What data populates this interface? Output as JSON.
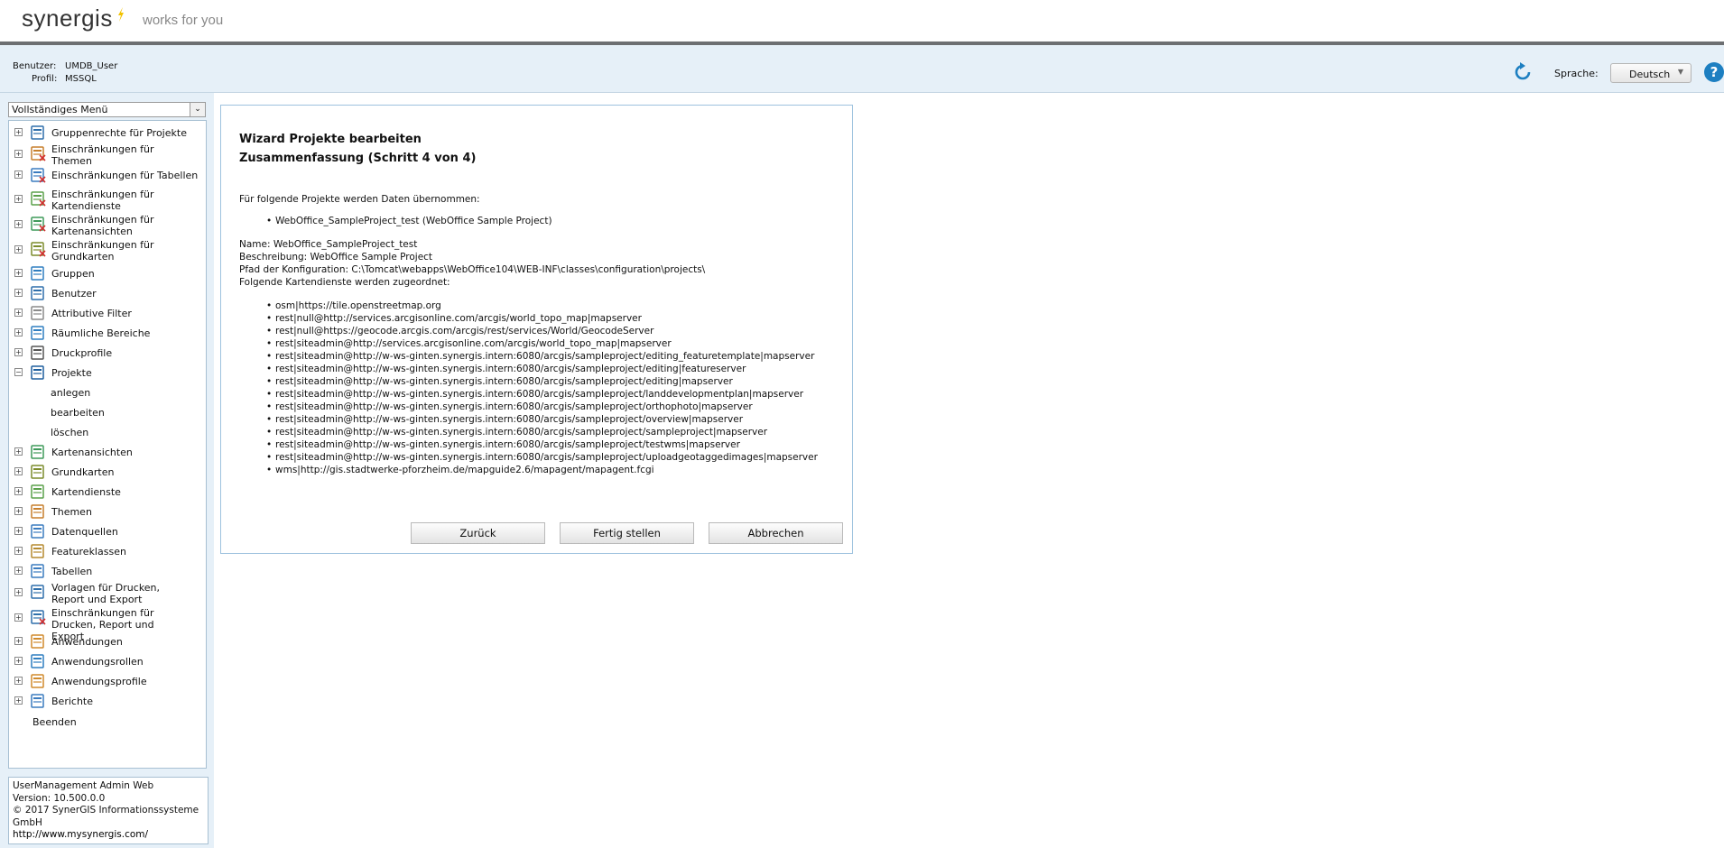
{
  "header": {
    "logo": "synergis",
    "tagline": "works for you"
  },
  "user_info": {
    "user_label": "Benutzer:",
    "user_value": "UMDB_User",
    "profile_label": "Profil:",
    "profile_value": "MSSQL"
  },
  "language": {
    "label": "Sprache:",
    "selected": "Deutsch"
  },
  "sidebar": {
    "menu_select": "Vollständiges Menü",
    "items": [
      {
        "label": "Gruppenrechte für Projekte",
        "icon": "group-rights-icon"
      },
      {
        "label": "Einschränkungen für Themen",
        "icon": "restrict-themes-icon"
      },
      {
        "label": "Einschränkungen für Tabellen",
        "icon": "restrict-tables-icon"
      },
      {
        "label": "Einschränkungen für Kartendienste",
        "icon": "restrict-mapservices-icon"
      },
      {
        "label": "Einschränkungen für Kartenansichten",
        "icon": "restrict-mapviews-icon"
      },
      {
        "label": "Einschränkungen für Grundkarten",
        "icon": "restrict-basemaps-icon"
      },
      {
        "label": "Gruppen",
        "icon": "groups-icon"
      },
      {
        "label": "Benutzer",
        "icon": "user-icon"
      },
      {
        "label": "Attributive Filter",
        "icon": "filter-icon"
      },
      {
        "label": "Räumliche Bereiche",
        "icon": "spatial-areas-icon"
      },
      {
        "label": "Druckprofile",
        "icon": "printer-icon"
      },
      {
        "label": "Projekte",
        "icon": "project-icon",
        "sub": [
          "anlegen",
          "bearbeiten",
          "löschen"
        ]
      },
      {
        "label": "Kartenansichten",
        "icon": "mapview-icon"
      },
      {
        "label": "Grundkarten",
        "icon": "basemap-icon"
      },
      {
        "label": "Kartendienste",
        "icon": "mapservice-icon"
      },
      {
        "label": "Themen",
        "icon": "themes-icon"
      },
      {
        "label": "Datenquellen",
        "icon": "datasource-icon"
      },
      {
        "label": "Featureklassen",
        "icon": "featureclass-icon"
      },
      {
        "label": "Tabellen",
        "icon": "table-icon"
      },
      {
        "label": "Vorlagen für Drucken, Report und Export",
        "icon": "templates-icon"
      },
      {
        "label": "Einschränkungen für Drucken, Report und Export",
        "icon": "restrict-templates-icon"
      },
      {
        "label": "Anwendungen",
        "icon": "application-icon"
      },
      {
        "label": "Anwendungsrollen",
        "icon": "app-roles-icon"
      },
      {
        "label": "Anwendungsprofile",
        "icon": "app-profiles-icon"
      },
      {
        "label": "Berichte",
        "icon": "reports-icon"
      }
    ],
    "exit": "Beenden"
  },
  "info": {
    "line1": "UserManagement Admin Web",
    "line2": "Version: 10.500.0.0",
    "line3": "© 2017 SynerGIS Informationssysteme",
    "line4": "GmbH",
    "link": "http://www.mysynergis.com/"
  },
  "wizard": {
    "title": "Wizard Projekte bearbeiten",
    "subtitle": "Zusammenfassung (Schritt 4 von 4)",
    "intro": "Für folgende Projekte werden Daten übernommen:",
    "project_entry": "WebOffice_SampleProject_test (WebOffice Sample Project)",
    "name": "Name: WebOffice_SampleProject_test",
    "description": "Beschreibung: WebOffice Sample Project",
    "config_path": "Pfad der Konfiguration: C:\\Tomcat\\webapps\\WebOffice104\\WEB-INF\\classes\\configuration\\projects\\",
    "services_intro": "Folgende Kartendienste werden zugeordnet:",
    "services": [
      "osm|https://tile.openstreetmap.org",
      "rest|null@http://services.arcgisonline.com/arcgis/world_topo_map|mapserver",
      "rest|null@https://geocode.arcgis.com/arcgis/rest/services/World/GeocodeServer",
      "rest|siteadmin@http://services.arcgisonline.com/arcgis/world_topo_map|mapserver",
      "rest|siteadmin@http://w-ws-ginten.synergis.intern:6080/arcgis/sampleproject/editing_featuretemplate|mapserver",
      "rest|siteadmin@http://w-ws-ginten.synergis.intern:6080/arcgis/sampleproject/editing|featureserver",
      "rest|siteadmin@http://w-ws-ginten.synergis.intern:6080/arcgis/sampleproject/editing|mapserver",
      "rest|siteadmin@http://w-ws-ginten.synergis.intern:6080/arcgis/sampleproject/landdevelopmentplan|mapserver",
      "rest|siteadmin@http://w-ws-ginten.synergis.intern:6080/arcgis/sampleproject/orthophoto|mapserver",
      "rest|siteadmin@http://w-ws-ginten.synergis.intern:6080/arcgis/sampleproject/overview|mapserver",
      "rest|siteadmin@http://w-ws-ginten.synergis.intern:6080/arcgis/sampleproject/sampleproject|mapserver",
      "rest|siteadmin@http://w-ws-ginten.synergis.intern:6080/arcgis/sampleproject/testwms|mapserver",
      "rest|siteadmin@http://w-ws-ginten.synergis.intern:6080/arcgis/sampleproject/uploadgeotaggedimages|mapserver",
      "wms|http://gis.stadtwerke-pforzheim.de/mapguide2.6/mapagent/mapagent.fcgi"
    ],
    "buttons": {
      "back": "Zurück",
      "finish": "Fertig stellen",
      "cancel": "Abbrechen"
    }
  }
}
